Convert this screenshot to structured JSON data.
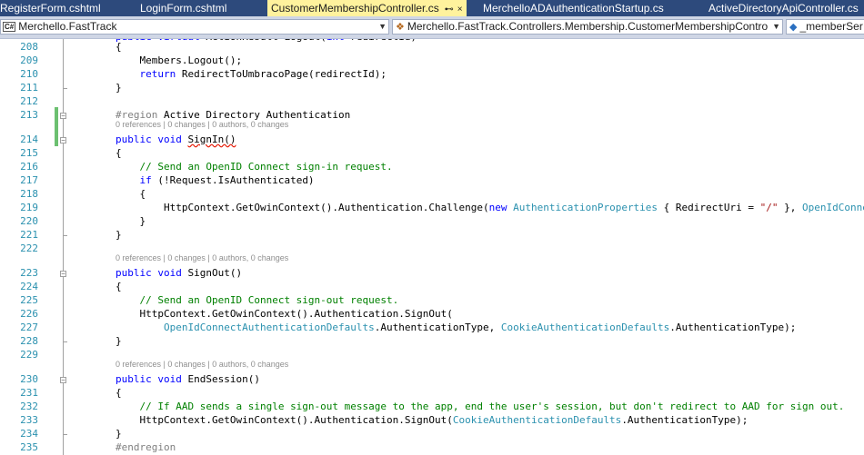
{
  "tabs": [
    {
      "label": "RegisterForm.cshtml",
      "active": false
    },
    {
      "label": "LoginForm.cshtml",
      "active": false
    },
    {
      "label": "CustomerMembershipController.cs",
      "active": true
    },
    {
      "label": "MerchelloADAuthenticationStartup.cs",
      "active": false
    },
    {
      "label": "ActiveDirectoryApiController.cs",
      "active": false
    }
  ],
  "tab_icons": {
    "pin": "⊷",
    "close": "×"
  },
  "navbar": {
    "project": "Merchello.FastTrack",
    "type": "Merchello.FastTrack.Controllers.Membership.CustomerMembershipContro",
    "member": "_memberSer",
    "cs_badge": "C#"
  },
  "codelens": "0 references | 0 changes | 0 authors, 0 changes",
  "lines": [
    {
      "n": "208",
      "segs": [
        [
          "{",
          ""
        ]
      ]
    },
    {
      "n": "209",
      "segs": [
        [
          "    Members.Logout();",
          ""
        ]
      ]
    },
    {
      "n": "210",
      "segs": [
        [
          "    ",
          ""
        ],
        [
          "return",
          "kw"
        ],
        [
          " RedirectToUmbracoPage(redirectId);",
          ""
        ]
      ]
    },
    {
      "n": "211",
      "segs": [
        [
          "}",
          ""
        ]
      ]
    },
    {
      "n": "212",
      "segs": []
    },
    {
      "n": "213",
      "segs": [
        [
          "#region",
          "pp"
        ],
        [
          " Active Directory Authentication",
          ""
        ]
      ]
    },
    {
      "n": "214",
      "segs": [
        [
          "public",
          "kw"
        ],
        [
          " ",
          ""
        ],
        [
          "void",
          "kw"
        ],
        [
          " ",
          ""
        ],
        [
          "SignIn()",
          "squig"
        ]
      ]
    },
    {
      "n": "215",
      "segs": [
        [
          "{",
          ""
        ]
      ]
    },
    {
      "n": "216",
      "segs": [
        [
          "    ",
          ""
        ],
        [
          "// Send an OpenID Connect sign-in request.",
          "cm"
        ]
      ]
    },
    {
      "n": "217",
      "segs": [
        [
          "    ",
          ""
        ],
        [
          "if",
          "kw"
        ],
        [
          " (!Request.IsAuthenticated)",
          ""
        ]
      ]
    },
    {
      "n": "218",
      "segs": [
        [
          "    {",
          ""
        ]
      ]
    },
    {
      "n": "219",
      "segs": [
        [
          "        HttpContext.GetOwinContext().Authentication.Challenge(",
          ""
        ],
        [
          "new",
          "kw"
        ],
        [
          " ",
          ""
        ],
        [
          "AuthenticationProperties",
          "ty"
        ],
        [
          " { RedirectUri = ",
          ""
        ],
        [
          "\"/\"",
          "st"
        ],
        [
          " }, ",
          ""
        ],
        [
          "OpenIdConnectAuthenticationDefaults",
          "ty"
        ]
      ]
    },
    {
      "n": "220",
      "segs": [
        [
          "    }",
          ""
        ]
      ]
    },
    {
      "n": "221",
      "segs": [
        [
          "}",
          ""
        ]
      ]
    },
    {
      "n": "222",
      "segs": []
    },
    {
      "n": "223",
      "segs": [
        [
          "public",
          "kw"
        ],
        [
          " ",
          ""
        ],
        [
          "void",
          "kw"
        ],
        [
          " SignOut()",
          ""
        ]
      ]
    },
    {
      "n": "224",
      "segs": [
        [
          "{",
          ""
        ]
      ]
    },
    {
      "n": "225",
      "segs": [
        [
          "    ",
          ""
        ],
        [
          "// Send an OpenID Connect sign-out request.",
          "cm"
        ]
      ]
    },
    {
      "n": "226",
      "segs": [
        [
          "    HttpContext.GetOwinContext().Authentication.SignOut(",
          ""
        ]
      ]
    },
    {
      "n": "227",
      "segs": [
        [
          "        ",
          ""
        ],
        [
          "OpenIdConnectAuthenticationDefaults",
          "ty"
        ],
        [
          ".AuthenticationType, ",
          ""
        ],
        [
          "CookieAuthenticationDefaults",
          "ty"
        ],
        [
          ".AuthenticationType);",
          ""
        ]
      ]
    },
    {
      "n": "228",
      "segs": [
        [
          "}",
          ""
        ]
      ]
    },
    {
      "n": "229",
      "segs": []
    },
    {
      "n": "230",
      "segs": [
        [
          "public",
          "kw"
        ],
        [
          " ",
          ""
        ],
        [
          "void",
          "kw"
        ],
        [
          " EndSession()",
          ""
        ]
      ]
    },
    {
      "n": "231",
      "segs": [
        [
          "{",
          ""
        ]
      ]
    },
    {
      "n": "232",
      "segs": [
        [
          "    ",
          ""
        ],
        [
          "// If AAD sends a single sign-out message to the app, end the user's session, but don't redirect to AAD for sign out.",
          "cm"
        ]
      ]
    },
    {
      "n": "233",
      "segs": [
        [
          "    HttpContext.GetOwinContext().Authentication.SignOut(",
          ""
        ],
        [
          "CookieAuthenticationDefaults",
          "ty"
        ],
        [
          ".AuthenticationType);",
          ""
        ]
      ]
    },
    {
      "n": "234",
      "segs": [
        [
          "}",
          ""
        ]
      ]
    },
    {
      "n": "235",
      "segs": [
        [
          "#endregion",
          "pp"
        ]
      ]
    }
  ]
}
